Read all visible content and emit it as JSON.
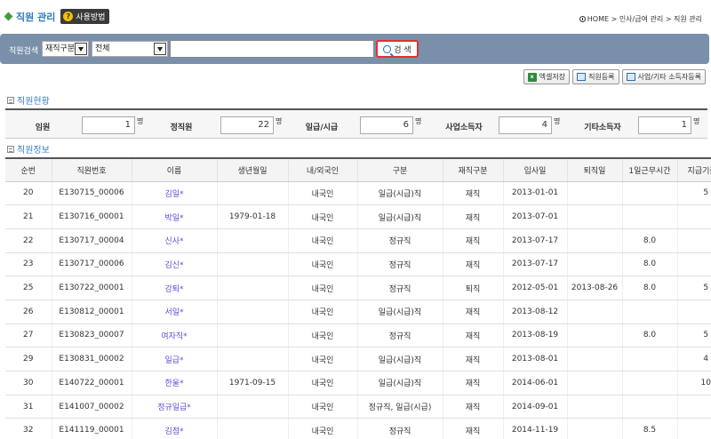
{
  "header": {
    "title": "직원 관리",
    "help_label": "사용방법",
    "breadcrumb": "HOME > 인사/급여 관리 > 직원 관리"
  },
  "search": {
    "label": "직원검색",
    "status_select": "재직구분",
    "type_select": "전체",
    "query": "",
    "button_label": "검 색"
  },
  "actions": {
    "excel": "엑셀저장",
    "register": "직원등록",
    "business_register": "사업/기타 소득자등록"
  },
  "summary": {
    "title": "직원현황",
    "items": [
      {
        "label": "임원",
        "value": "1",
        "unit": "명"
      },
      {
        "label": "정직원",
        "value": "22",
        "unit": "명"
      },
      {
        "label": "일급/시급",
        "value": "6",
        "unit": "명"
      },
      {
        "label": "사업소득자",
        "value": "4",
        "unit": "명"
      },
      {
        "label": "기타소득자",
        "value": "1",
        "unit": "명"
      }
    ]
  },
  "employees": {
    "title": "직원정보",
    "columns": [
      "순번",
      "직원번호",
      "이름",
      "생년월일",
      "내/외국인",
      "구분",
      "재직구분",
      "입사일",
      "퇴직일",
      "1일근무시간",
      "지급기준일"
    ],
    "rows": [
      [
        "20",
        "E130715_00006",
        "김일*",
        "",
        "내국인",
        "일급(시급)직",
        "재직",
        "2013-01-01",
        "",
        "",
        "5"
      ],
      [
        "21",
        "E130716_00001",
        "박일*",
        "1979-01-18",
        "내국인",
        "일급(시급)직",
        "재직",
        "2013-07-01",
        "",
        "",
        ""
      ],
      [
        "22",
        "E130717_00004",
        "신사*",
        "",
        "내국인",
        "정규직",
        "재직",
        "2013-07-17",
        "",
        "8.0",
        ""
      ],
      [
        "23",
        "E130717_00006",
        "김신*",
        "",
        "내국인",
        "정규직",
        "재직",
        "2013-07-17",
        "",
        "8.0",
        ""
      ],
      [
        "25",
        "E130722_00001",
        "강퇴*",
        "",
        "내국인",
        "정규직",
        "퇴직",
        "2012-05-01",
        "2013-08-26",
        "8.0",
        "5"
      ],
      [
        "26",
        "E130812_00001",
        "서일*",
        "",
        "내국인",
        "일급(시급)직",
        "재직",
        "2013-08-12",
        "",
        "",
        ""
      ],
      [
        "27",
        "E130823_00007",
        "여자직*",
        "",
        "내국인",
        "정규직",
        "재직",
        "2013-08-19",
        "",
        "8.0",
        "5"
      ],
      [
        "29",
        "E130831_00002",
        "일급*",
        "",
        "내국인",
        "일급(시급)직",
        "재직",
        "2013-08-01",
        "",
        "",
        "4"
      ],
      [
        "30",
        "E140722_00001",
        "한울*",
        "1971-09-15",
        "내국인",
        "일급(시급)직",
        "재직",
        "2014-06-01",
        "",
        "",
        "10"
      ],
      [
        "31",
        "E141007_00002",
        "정규일급*",
        "",
        "내국인",
        "정규직, 일급(시급)",
        "재직",
        "2014-09-01",
        "",
        "",
        ""
      ],
      [
        "32",
        "E141119_00001",
        "김점*",
        "",
        "내국인",
        "정규직",
        "재직",
        "2014-11-19",
        "",
        "8.5",
        ""
      ]
    ]
  }
}
